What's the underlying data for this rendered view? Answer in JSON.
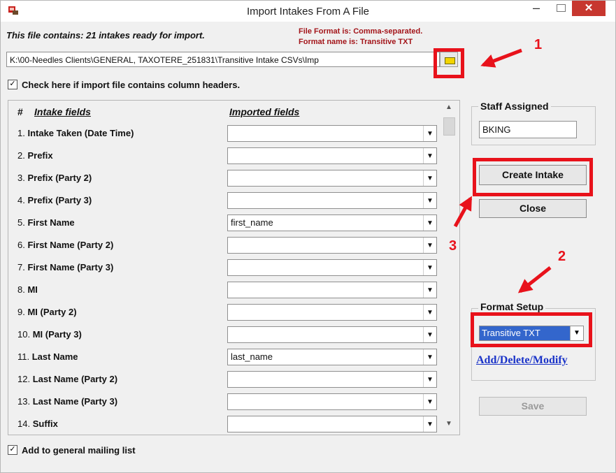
{
  "window": {
    "title": "Import Intakes From A File",
    "minimize_glyph": "–",
    "close_glyph": "✕",
    "icon": "app-import-icon"
  },
  "file_info": {
    "summary": "This file contains: 21 intakes ready for import.",
    "format_line": "File Format is: Comma-separated.",
    "format_name_line": "Format name is: Transitive TXT",
    "path": "K:\\00-Needles Clients\\GENERAL, TAXOTERE_251831\\Transitive Intake CSVs\\Imp",
    "browse_icon": "folder-icon"
  },
  "headers_checkbox": {
    "checked": true,
    "label": "Check here if import file contains column headers."
  },
  "mapping": {
    "col_num": "#",
    "col_intake": "Intake fields",
    "col_imported": "Imported fields",
    "rows": [
      {
        "num": "1.",
        "field": "Intake Taken (Date Time)",
        "value": ""
      },
      {
        "num": "2.",
        "field": "Prefix",
        "value": ""
      },
      {
        "num": "3.",
        "field": "Prefix (Party 2)",
        "value": ""
      },
      {
        "num": "4.",
        "field": "Prefix (Party 3)",
        "value": ""
      },
      {
        "num": "5.",
        "field": "First Name",
        "value": "first_name"
      },
      {
        "num": "6.",
        "field": "First Name (Party 2)",
        "value": ""
      },
      {
        "num": "7.",
        "field": "First Name (Party 3)",
        "value": ""
      },
      {
        "num": "8.",
        "field": "MI",
        "value": ""
      },
      {
        "num": "9.",
        "field": "MI (Party 2)",
        "value": ""
      },
      {
        "num": "10.",
        "field": "MI (Party 3)",
        "value": ""
      },
      {
        "num": "11.",
        "field": "Last Name",
        "value": "last_name"
      },
      {
        "num": "12.",
        "field": "Last Name (Party 2)",
        "value": ""
      },
      {
        "num": "13.",
        "field": "Last Name (Party 3)",
        "value": ""
      },
      {
        "num": "14.",
        "field": "Suffix",
        "value": ""
      }
    ]
  },
  "staff": {
    "title": "Staff Assigned",
    "value": "BKING"
  },
  "buttons": {
    "create": "Create Intake",
    "close": "Close",
    "save": "Save"
  },
  "format_setup": {
    "title": "Format Setup",
    "selected": "Transitive TXT",
    "link": "Add/Delete/Modify"
  },
  "mailing_checkbox": {
    "checked": true,
    "label": "Add to general mailing list"
  },
  "annotations": {
    "step1": "1",
    "step2": "2",
    "step3": "3",
    "color": "#e8121b"
  }
}
